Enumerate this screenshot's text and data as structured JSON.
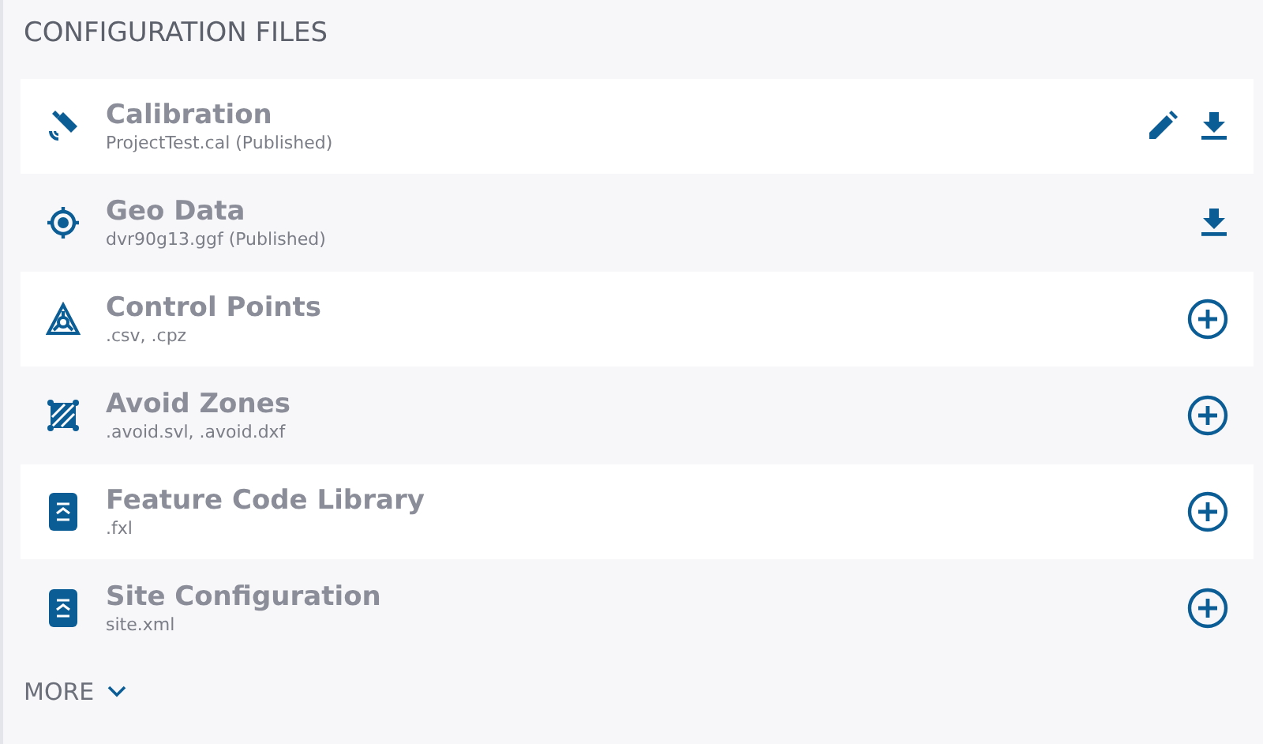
{
  "heading": "CONFIGURATION FILES",
  "files": [
    {
      "kind": "satellite",
      "title": "Calibration",
      "detail": "ProjectTest.cal (Published)",
      "actions": [
        {
          "kind": "edit"
        },
        {
          "kind": "download"
        }
      ]
    },
    {
      "kind": "target",
      "title": "Geo Data",
      "detail": "dvr90g13.ggf (Published)",
      "actions": [
        {
          "kind": "download"
        }
      ]
    },
    {
      "kind": "triangle",
      "title": "Control Points",
      "detail": ".csv, .cpz",
      "actions": [
        {
          "kind": "add"
        }
      ]
    },
    {
      "kind": "zone",
      "title": "Avoid Zones",
      "detail": ".avoid.svl, .avoid.dxf",
      "actions": [
        {
          "kind": "add"
        }
      ]
    },
    {
      "kind": "book",
      "title": "Feature Code Library",
      "detail": ".fxl",
      "actions": [
        {
          "kind": "add"
        }
      ]
    },
    {
      "kind": "book",
      "title": "Site Configuration",
      "detail": "site.xml",
      "actions": [
        {
          "kind": "add"
        }
      ]
    }
  ],
  "more": {
    "label": "MORE",
    "expanded": false
  }
}
